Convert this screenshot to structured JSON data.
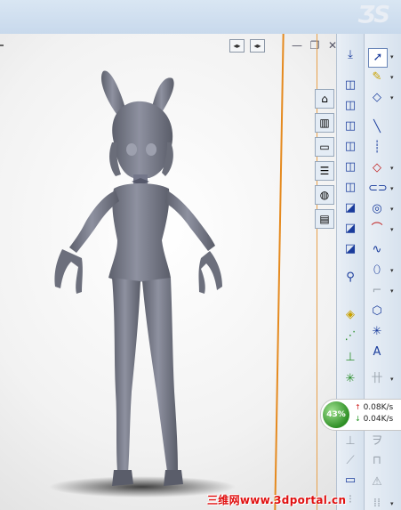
{
  "viewport": {
    "view_controls": [
      "restore-view-icon",
      "fit-view-icon"
    ],
    "window_controls": [
      "minimize-icon",
      "restore-icon",
      "close-icon"
    ]
  },
  "task_pane": {
    "tabs": [
      "home-icon",
      "design-library-icon",
      "file-explorer-icon",
      "view-palette-icon",
      "appearances-icon",
      "custom-properties-icon"
    ]
  },
  "toolbar_left": {
    "items": [
      "normal-to-icon",
      "view-cube-icon",
      "view-cube-2-icon",
      "view-cube-3-icon",
      "view-cube-4-icon",
      "view-cube-5-icon",
      "view-cube-6-icon",
      "view-cube-7-icon",
      "view-cube-8-icon",
      "view-cube-9-icon",
      "section-view-icon",
      "smart-dimension-icon",
      "centerline-icon",
      "axis-icon",
      "pattern-icon",
      "mirror-icon",
      "offset-icon",
      "line-tool-icon",
      "rectangle-icon"
    ]
  },
  "toolbar_right": {
    "items": [
      "select-icon",
      "sketch-icon",
      "smart-dim-icon",
      "line-icon",
      "centerline-dash-icon",
      "polygon-icon",
      "slot-icon",
      "circle-icon",
      "arc-icon",
      "spline-icon",
      "ellipse-icon",
      "fillet-icon",
      "hexagon-icon",
      "point-icon",
      "text-icon",
      "grid-icon",
      "chamfer-icon",
      "offset-entities-icon",
      "warning-icon",
      "pattern-grid-icon"
    ]
  },
  "network_monitor": {
    "percent": "43%",
    "upload": "0.08K/s",
    "download": "0.04K/s",
    "up_arrow": "↑",
    "down_arrow": "↓"
  },
  "watermark": {
    "text": "三维网www.3dportal.cn"
  },
  "colors": {
    "figure_fill": "#7b7f8c",
    "accent_orange": "#e58a1f",
    "watermark_red": "#e01010",
    "monitor_green": "#2e8f25"
  }
}
